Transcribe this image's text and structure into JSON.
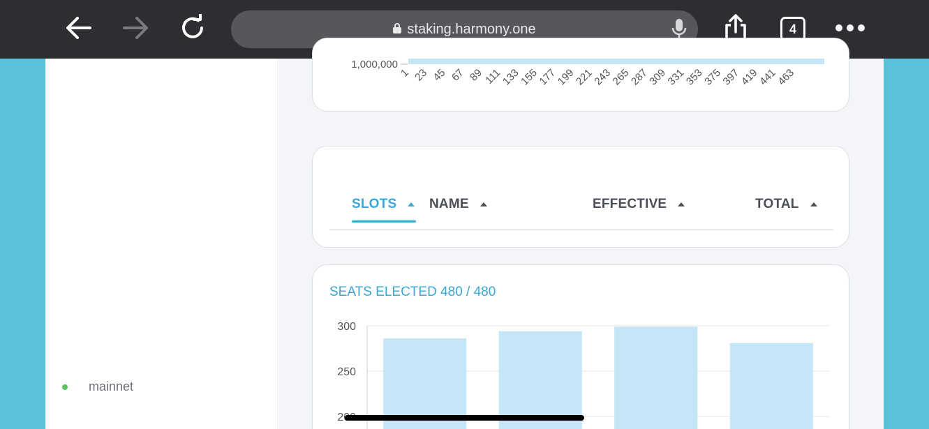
{
  "browser": {
    "url": "staking.harmony.one",
    "tab_count": "4",
    "icons": [
      "back-arrow-icon",
      "forward-arrow-icon",
      "reload-icon",
      "lock-icon",
      "microphone-icon",
      "share-icon",
      "tabs-icon",
      "more-icon"
    ]
  },
  "sidebar": {
    "network_label": "mainnet",
    "network_status_color": "#5ac25e"
  },
  "top_chart": {
    "y_tick_label": "1,000,000",
    "x_labels": [
      "1",
      "23",
      "45",
      "67",
      "89",
      "111",
      "133",
      "155",
      "177",
      "199",
      "221",
      "243",
      "265",
      "287",
      "309",
      "331",
      "353",
      "375",
      "397",
      "419",
      "441",
      "463"
    ]
  },
  "table": {
    "columns": [
      {
        "label": "SLOTS",
        "active": true
      },
      {
        "label": "NAME",
        "active": false
      },
      {
        "label": "EFFECTIVE",
        "active": false
      },
      {
        "label": "TOTAL",
        "active": false
      }
    ]
  },
  "seats": {
    "title": "SEATS ELECTED 480 / 480"
  },
  "chart_data": {
    "type": "bar",
    "categories": [
      "",
      "",
      "",
      ""
    ],
    "values": [
      286,
      294,
      299,
      281
    ],
    "ylim": [
      200,
      300
    ],
    "y_ticks": [
      "300",
      "250",
      "200"
    ],
    "bar_color": "#c5e6f6",
    "grid": true
  },
  "colors": {
    "accent": "#3aa7d9",
    "frame_background": "#5bc1da",
    "toolbar": "#2d2e31"
  }
}
